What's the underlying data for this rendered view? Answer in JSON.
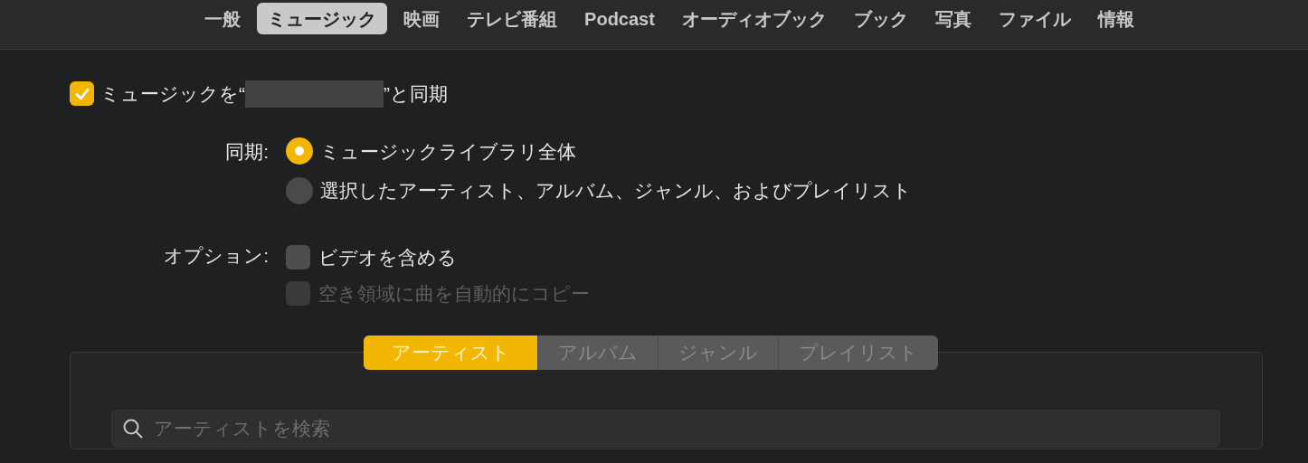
{
  "tabs": [
    {
      "label": "一般",
      "selected": false
    },
    {
      "label": "ミュージック",
      "selected": true
    },
    {
      "label": "映画",
      "selected": false
    },
    {
      "label": "テレビ番組",
      "selected": false
    },
    {
      "label": "Podcast",
      "selected": false
    },
    {
      "label": "オーディオブック",
      "selected": false
    },
    {
      "label": "ブック",
      "selected": false
    },
    {
      "label": "写真",
      "selected": false
    },
    {
      "label": "ファイル",
      "selected": false
    },
    {
      "label": "情報",
      "selected": false
    }
  ],
  "sync_music": {
    "label_before": "ミュージックを“",
    "label_after": "”と同期",
    "checked": true
  },
  "sync_mode": {
    "label": "同期:",
    "options": [
      {
        "label": "ミュージックライブラリ全体",
        "selected": true
      },
      {
        "label": "選択したアーティスト、アルバム、ジャンル、およびプレイリスト",
        "selected": false
      }
    ]
  },
  "options": {
    "label": "オプション:",
    "items": [
      {
        "label": "ビデオを含める",
        "checked": false,
        "disabled": false
      },
      {
        "label": "空き領域に曲を自動的にコピー",
        "checked": false,
        "disabled": true
      }
    ]
  },
  "browser": {
    "disabled": true,
    "segments": [
      {
        "label": "アーティスト",
        "selected": true
      },
      {
        "label": "アルバム",
        "selected": false
      },
      {
        "label": "ジャンル",
        "selected": false
      },
      {
        "label": "プレイリスト",
        "selected": false
      }
    ],
    "search": {
      "placeholder": "アーティストを検索"
    }
  }
}
